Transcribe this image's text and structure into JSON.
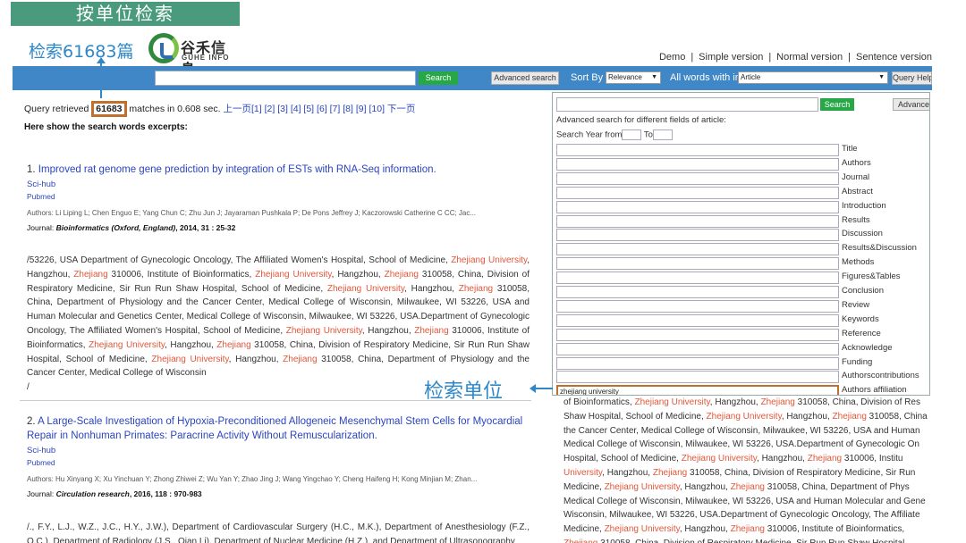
{
  "banner": {
    "title": "按单位检索"
  },
  "annotations": {
    "count_prefix": "检索",
    "count_value": "61683",
    "count_suffix": "篇",
    "unit_label": "检索单位"
  },
  "logo": {
    "cn": "谷禾信息",
    "en": "GUHE INFO"
  },
  "top_links": [
    "Demo",
    "Simple version",
    "Normal version",
    "Sentence version"
  ],
  "toolbar": {
    "search_label": "Search",
    "advanced_label": "Advanced search",
    "sort_label": "Sort By",
    "sort_value": "Relevance",
    "words_label": "All words with in",
    "scope_value": "Article",
    "help_label": "Query Help"
  },
  "query": {
    "prefix": "Query retrieved",
    "count": "61683",
    "suffix": "matches in 0.608 sec.",
    "prev": "上一页",
    "pages": [
      "[1]",
      "[2]",
      "[3]",
      "[4]",
      "[5]",
      "[6]",
      "[7]",
      "[8]",
      "[9]",
      "[10]"
    ],
    "next": "下一页",
    "excerpt_heading": "Here show the search words excerpts:"
  },
  "results": [
    {
      "number": "1.",
      "title": "Improved rat genome gene prediction by integration of ESTs with RNA-Seq information.",
      "scihub": "Sci-hub",
      "pubmed": "Pubmed",
      "authors": "Authors: Li Liping L; Chen Enguo E; Yang Chun C; Zhu Jun J; Jayaraman Pushkala P; De Pons Jeffrey J; Kaczorowski Catherine C CC; Jac...",
      "journal_prefix": "Journal:",
      "journal_name": "Bioinformatics (Oxford, England)",
      "journal_suffix": ", 2014, 31 : 25-32",
      "affiliation_parts": [
        "/53226, USA Department of Gynecologic Oncology, The Affiliated Women's Hospital, School of Medicine, ",
        "Zhejiang University",
        ", Hangzhou, ",
        "Zhejiang",
        " 310006, Institute of Bioinformatics, ",
        "Zhejiang University",
        ", Hangzhou, ",
        "Zhejiang",
        " 310058, China, Division of Respiratory Medicine, Sir Run Run Shaw Hospital, School of Medicine, ",
        "Zhejiang University",
        ", Hangzhou, ",
        "Zhejiang",
        " 310058, China, Department of Physiology and the Cancer Center, Medical College of Wisconsin, Milwaukee, WI 53226, USA and Human Molecular and Genetics Center, Medical College of Wisconsin, Milwaukee, WI 53226, USA.Department of Gynecologic Oncology, The Affiliated Women's Hospital, School of Medicine, ",
        "Zhejiang University",
        ", Hangzhou, ",
        "Zhejiang",
        " 310006, Institute of Bioinformatics, ",
        "Zhejiang University",
        ", Hangzhou, ",
        "Zhejiang",
        " 310058, China, Division of Respiratory Medicine, Sir Run Run Shaw Hospital, School of Medicine, ",
        "Zhejiang University",
        ", Hangzhou, ",
        "Zhejiang",
        " 310058, China, Department of Physiology and the Cancer Center, Medical College of Wisconsin\n/"
      ]
    },
    {
      "number": "2.",
      "title": "A Large-Scale Investigation of Hypoxia-Preconditioned Allogeneic Mesenchymal Stem Cells for Myocardial Repair in Nonhuman Primates: Paracrine Activity Without Remuscularization.",
      "scihub": "Sci-hub",
      "pubmed": "Pubmed",
      "authors": "Authors: Hu Xinyang X; Xu Yinchuan Y; Zhong Zhiwei Z; Wu Yan Y; Zhao Jing J; Wang Yingchao Y; Cheng Haifeng H; Kong Minjian M; Zhan...",
      "journal_prefix": "Journal:",
      "journal_name": "Circulation research",
      "journal_suffix": ", 2016, 118 : 970-983",
      "affiliation_parts": [
        "/., F.Y., L.J., W.Z., J.C., H.Y., J.W.), Department of Cardiovascular Surgery (H.C., M.K.), Department of Anesthesiology (F.Z., Q.C.), Department of Radiology (J.S., Qian Li), Department of Nuclear Medicine (H.Z.), and Department of Ultrasonography"
      ]
    }
  ],
  "advanced_panel": {
    "search_label": "Search",
    "advanced_label": "Advanced",
    "description": "Advanced search for different fields of article:",
    "year_from_label": "Search Year from",
    "year_to_label": "To",
    "fields": [
      {
        "label": "Title",
        "value": ""
      },
      {
        "label": "Authors",
        "value": ""
      },
      {
        "label": "Journal",
        "value": ""
      },
      {
        "label": "Abstract",
        "value": ""
      },
      {
        "label": "Introduction",
        "value": ""
      },
      {
        "label": "Results",
        "value": ""
      },
      {
        "label": "Discussion",
        "value": ""
      },
      {
        "label": "Results&Discussion",
        "value": ""
      },
      {
        "label": "Methods",
        "value": ""
      },
      {
        "label": "Figures&Tables",
        "value": ""
      },
      {
        "label": "Conclusion",
        "value": ""
      },
      {
        "label": "Review",
        "value": ""
      },
      {
        "label": "Keywords",
        "value": ""
      },
      {
        "label": "Reference",
        "value": ""
      },
      {
        "label": "Acknowledge",
        "value": ""
      },
      {
        "label": "Funding",
        "value": ""
      },
      {
        "label": "Authorscontributions",
        "value": ""
      },
      {
        "label": "Authors affiliation",
        "value": "zhejiang university"
      }
    ]
  },
  "right_background_parts": [
    "of Bioinformatics, ",
    "Zhejiang University",
    ", Hangzhou, ",
    "Zhejiang",
    " 310058, China, Division of Res",
    "\nShaw Hospital, School of Medicine, ",
    "Zhejiang University",
    ", Hangzhou, ",
    "Zhejiang",
    " 310058, China",
    "\nthe Cancer Center, Medical College of Wisconsin, Milwaukee, WI 53226, USA and Human",
    "\nMedical College of Wisconsin, Milwaukee, WI 53226, USA.Department of Gynecologic On",
    "\nHospital, School of Medicine, ",
    "Zhejiang University",
    ", Hangzhou, ",
    "Zhejiang",
    " 310006, Institu",
    "\n",
    "University",
    ", Hangzhou, ",
    "Zhejiang",
    " 310058, China, Division of Respiratory Medicine, Sir Run",
    "\nMedicine, ",
    "Zhejiang University",
    ", Hangzhou, ",
    "Zhejiang",
    " 310058, China, Department of Phys",
    "\nMedical College of Wisconsin, Milwaukee, WI 53226, USA and Human Molecular and Gene",
    "\nWisconsin, Milwaukee, WI 53226, USA.Department of Gynecologic Oncology, The Affiliate",
    "\nMedicine, ",
    "Zhejiang University",
    ", Hangzhou, ",
    "Zhejiang",
    " 310006, Institute of Bioinformatics, ",
    "\n",
    "Zhejiang",
    " 310058, China, Division of Respiratory Medicine, Sir Run Run Shaw Hospital"
  ],
  "colors": {
    "banner": "#4a9a7e",
    "toolbar": "#3f87c6",
    "button_green": "#28a746",
    "link_blue": "#2a45c0",
    "highlight_orange": "#c0702e",
    "keyword_red": "#e2573a",
    "annotation_blue": "#2e88c8"
  }
}
